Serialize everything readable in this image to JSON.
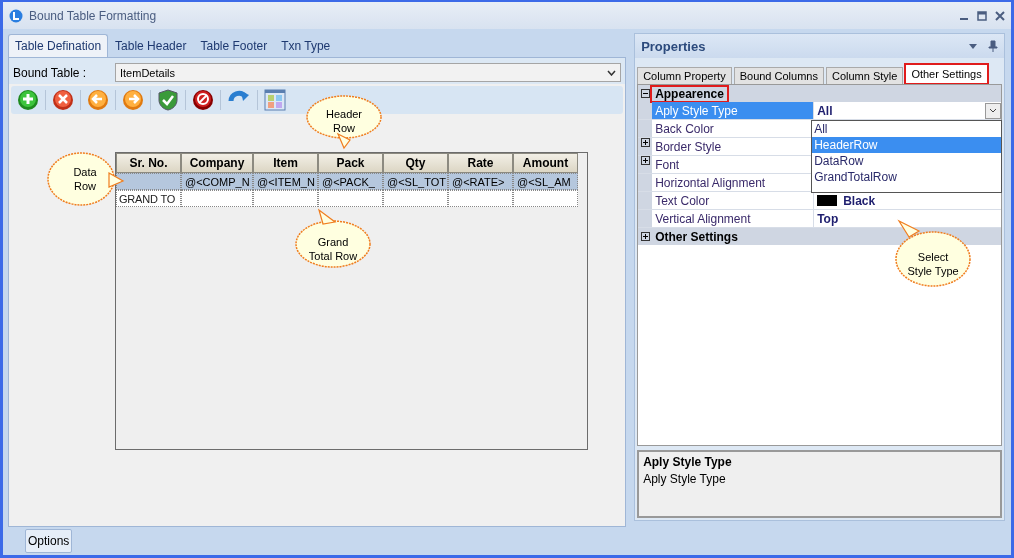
{
  "window": {
    "title": "Bound Table Formatting"
  },
  "tabs": [
    {
      "label": "Table Defination",
      "selected": true
    },
    {
      "label": "Table Header",
      "selected": false
    },
    {
      "label": "Table Footer",
      "selected": false
    },
    {
      "label": "Txn Type",
      "selected": false
    }
  ],
  "bound_table": {
    "label": "Bound Table :",
    "value": "ItemDetails"
  },
  "table": {
    "columns": [
      "Sr. No.",
      "Company",
      "Item",
      "Pack",
      "Qty",
      "Rate",
      "Amount"
    ],
    "rows": [
      {
        "kind": "data",
        "selected": true,
        "cells": [
          "",
          "@<COMP_N",
          "@<ITEM_N",
          "@<PACK_",
          "@<SL_TOT",
          "@<RATE>",
          "@<SL_AM"
        ]
      },
      {
        "kind": "total",
        "selected": false,
        "cells": [
          "GRAND TO",
          "",
          "",
          "",
          "",
          "",
          ""
        ]
      }
    ]
  },
  "callouts": [
    {
      "text": "Header\nRow",
      "kind": "down"
    },
    {
      "text": "Data\nRow",
      "kind": "right"
    },
    {
      "text": "Grand\nTotal Row",
      "kind": "up"
    },
    {
      "text": "Select\nStyle Type",
      "kind": "upleft"
    }
  ],
  "properties": {
    "title": "Properties",
    "tabs": [
      {
        "label": "Column Property",
        "selected": false,
        "highlighted": false
      },
      {
        "label": "Bound Columns",
        "selected": false,
        "highlighted": false
      },
      {
        "label": "Column Style",
        "selected": false,
        "highlighted": false
      },
      {
        "label": "Other Settings",
        "selected": true,
        "highlighted": true
      }
    ],
    "categories": [
      {
        "label": "Appearence",
        "expanded": true,
        "highlighted": true,
        "rows": [
          {
            "name": "Aply Style Type",
            "value": "All",
            "selected": true,
            "kind": "list"
          },
          {
            "name": "Back Color",
            "selected": false,
            "kind": "text"
          },
          {
            "name": "Border Style",
            "selected": false,
            "kind": "group"
          },
          {
            "name": "Font",
            "selected": false,
            "kind": "group"
          },
          {
            "name": "Horizontal Alignment",
            "selected": false,
            "kind": "text"
          },
          {
            "name": "Text Color",
            "value": "Black",
            "selected": false,
            "kind": "color"
          },
          {
            "name": "Vertical Alignment",
            "value": "Top",
            "selected": false,
            "kind": "text"
          }
        ]
      },
      {
        "label": "Other Settings",
        "expanded": false,
        "highlighted": false
      }
    ],
    "dropdown": {
      "options": [
        {
          "label": "All",
          "selected": false
        },
        {
          "label": "HeaderRow",
          "selected": true
        },
        {
          "label": "DataRow",
          "selected": false
        },
        {
          "label": "GrandTotalRow",
          "selected": false
        }
      ]
    },
    "description": {
      "title": "Aply Style Type",
      "text": "Aply Style Type"
    }
  },
  "bottom_button": "Options"
}
